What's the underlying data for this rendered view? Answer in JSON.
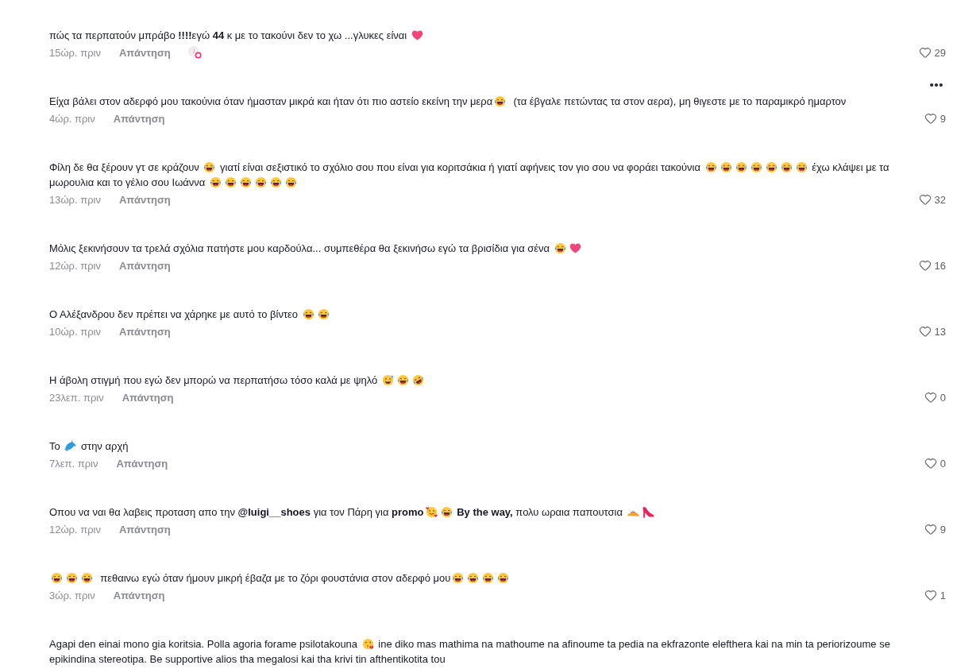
{
  "comments": [
    {
      "body": [
        {
          "kind": "text",
          "text": "πώς τα περπατούν μπράβο **!!!!**εγώ **44** κ με το τακούνι δεν το χω ...γλυκες είναι "
        },
        {
          "kind": "heart"
        }
      ],
      "time": "15ώρ. πριν",
      "reply": "Απάντηση",
      "likes": "29",
      "creator_liked": true,
      "menu_shown": false
    },
    {
      "body": [
        {
          "kind": "text",
          "text": "Είχα βάλει στον αδερφό μου τακούνια όταν ήμασταν μικρά και ήταν ότι πιο αστείο εκείνη την μερα"
        },
        {
          "kind": "laugh"
        },
        {
          "kind": "text",
          "text": "  (τα έβγαλε πετώντας τα στον αερα), μη θιγεστε με το παραμικρό ημαρτον"
        }
      ],
      "time": "4ώρ. πριν",
      "reply": "Απάντηση",
      "likes": "9",
      "creator_liked": false,
      "menu_shown": true
    },
    {
      "body": [
        {
          "kind": "text",
          "text": "Φίλη δε θα ξέρουν γτ σε κράζουν "
        },
        {
          "kind": "laugh"
        },
        {
          "kind": "text",
          "text": " γιατί είναι σεξιστικό το σχόλιο σου που είναι για κοριτσάκια ή γιατί αφήνεις τον γιο σου να φοράει τακούνια "
        },
        {
          "kind": "laugh"
        },
        {
          "kind": "laugh"
        },
        {
          "kind": "laugh"
        },
        {
          "kind": "laugh"
        },
        {
          "kind": "laugh"
        },
        {
          "kind": "laugh"
        },
        {
          "kind": "laugh"
        },
        {
          "kind": "text",
          "text": " έχω κλάψει με τα μωρουλια και το γέλιο σου Ιωάννα "
        },
        {
          "kind": "laugh"
        },
        {
          "kind": "laugh"
        },
        {
          "kind": "laugh"
        },
        {
          "kind": "laugh"
        },
        {
          "kind": "laugh"
        },
        {
          "kind": "laugh"
        }
      ],
      "time": "13ώρ. πριν",
      "reply": "Απάντηση",
      "likes": "32",
      "creator_liked": false,
      "menu_shown": false
    },
    {
      "body": [
        {
          "kind": "text",
          "text": "Μόλις ξεκινήσουν τα τρελά σχόλια πατήστε μου καρδούλα... συμπεθέρα θα ξεκινήσω εγώ τα βρισίδια για σένα "
        },
        {
          "kind": "laugh"
        },
        {
          "kind": "heart"
        }
      ],
      "time": "12ώρ. πριν",
      "reply": "Απάντηση",
      "likes": "16",
      "creator_liked": false,
      "menu_shown": false
    },
    {
      "body": [
        {
          "kind": "text",
          "text": "Ο Αλέξανδρου δεν πρέπει να χάρηκε με αυτό το βίντεο "
        },
        {
          "kind": "laugh"
        },
        {
          "kind": "laugh"
        }
      ],
      "time": "10ώρ. πριν",
      "reply": "Απάντηση",
      "likes": "13",
      "creator_liked": false,
      "menu_shown": false
    },
    {
      "body": [
        {
          "kind": "text",
          "text": "Η άβολη στιγμή που εγώ δεν μπορώ να περπατήσω τόσο καλά με ψηλό "
        },
        {
          "kind": "sweat"
        },
        {
          "kind": "laugh"
        },
        {
          "kind": "rofl"
        }
      ],
      "time": "23λεπ. πριν",
      "reply": "Απάντηση",
      "likes": "0",
      "creator_liked": false,
      "menu_shown": false
    },
    {
      "body": [
        {
          "kind": "text",
          "text": "Το "
        },
        {
          "kind": "dolphin"
        },
        {
          "kind": "text",
          "text": " στην αρχή"
        }
      ],
      "time": "7λεπ. πριν",
      "reply": "Απάντηση",
      "likes": "0",
      "creator_liked": false,
      "menu_shown": false
    },
    {
      "body": [
        {
          "kind": "text",
          "text": "Οπου να ναι θα λαβεις προταση απο την **@luigi__shoes** για τον Πάρη για **promo**"
        },
        {
          "kind": "hearts"
        },
        {
          "kind": "laugh"
        },
        {
          "kind": "text",
          "text": " **By the way,** πολυ ωραια παπουτσια "
        },
        {
          "kind": "sandal"
        },
        {
          "kind": "heel"
        }
      ],
      "time": "12ώρ. πριν",
      "reply": "Απάντηση",
      "likes": "9",
      "creator_liked": false,
      "menu_shown": false
    },
    {
      "body": [
        {
          "kind": "laugh"
        },
        {
          "kind": "laugh"
        },
        {
          "kind": "laugh"
        },
        {
          "kind": "text",
          "text": "  πεθαινω εγώ όταν ήμουν μικρή έβαζα με το ζόρι φουστάνια στον αδερφό μου"
        },
        {
          "kind": "laugh"
        },
        {
          "kind": "laugh"
        },
        {
          "kind": "laugh"
        },
        {
          "kind": "laugh"
        }
      ],
      "time": "3ώρ. πριν",
      "reply": "Απάντηση",
      "likes": "1",
      "creator_liked": false,
      "menu_shown": false
    },
    {
      "body": [
        {
          "kind": "text",
          "text": "Agapi den einai mono gia koritsia. Polla agoria forame psilotakouna "
        },
        {
          "kind": "kiss"
        },
        {
          "kind": "text",
          "text": " ine diko mas mathima na mathoume na afinoume ta pedia na ekfrazonte elefthera kai na min ta periorizoume se epikindina stereotipa. Be supportive alios tha megalosi kai tha krivi tin afthentikotita tou"
        }
      ],
      "creator_liked": false,
      "menu_shown": false
    }
  ]
}
